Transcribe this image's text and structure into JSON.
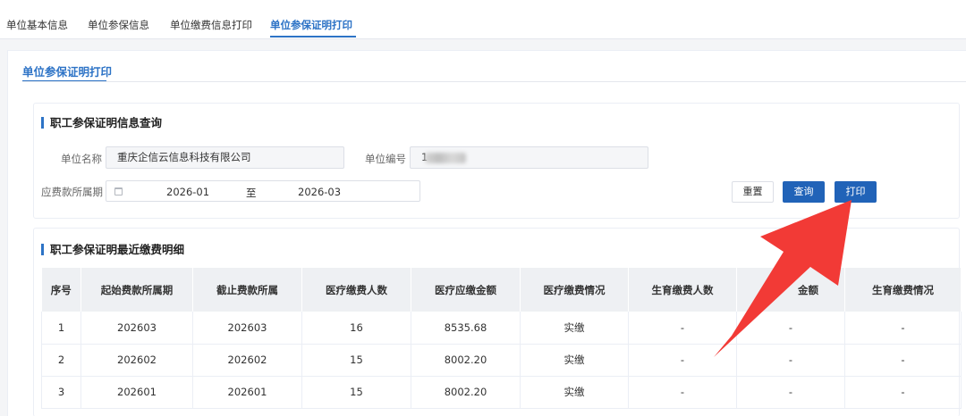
{
  "top_tabs": [
    {
      "label": "单位基本信息",
      "active": false
    },
    {
      "label": "单位参保信息",
      "active": false
    },
    {
      "label": "单位缴费信息打印",
      "active": false
    },
    {
      "label": "单位参保证明打印",
      "active": true
    }
  ],
  "sub_tab": {
    "label": "单位参保证明打印"
  },
  "query": {
    "title": "职工参保证明信息查询",
    "unit_name_label": "单位名称",
    "unit_name_value": "重庆企信云信息科技有限公司",
    "unit_code_label": "单位编号",
    "unit_code_value": "1",
    "period_label": "应费款所属期",
    "period_start": "2026-01",
    "period_sep": "至",
    "period_end": "2026-03",
    "reset_label": "重置",
    "search_label": "查询",
    "print_label": "打印"
  },
  "detail": {
    "title": "职工参保证明最近缴费明细",
    "columns": [
      "序号",
      "起始费款所属期",
      "截止费款所属",
      "医疗缴费人数",
      "医疗应缴金额",
      "医疗缴费情况",
      "生育缴费人数",
      "金额",
      "生育缴费情况"
    ],
    "rows": [
      [
        "1",
        "202603",
        "202603",
        "16",
        "8535.68",
        "实缴",
        "-",
        "-",
        "-"
      ],
      [
        "2",
        "202602",
        "202602",
        "15",
        "8002.20",
        "实缴",
        "-",
        "-",
        "-"
      ],
      [
        "3",
        "202601",
        "202601",
        "15",
        "8002.20",
        "实缴",
        "-",
        "-",
        "-"
      ]
    ]
  },
  "colors": {
    "accent": "#2d73c6",
    "primary_button": "#2163b8",
    "annotation_arrow": "#f23a36"
  }
}
